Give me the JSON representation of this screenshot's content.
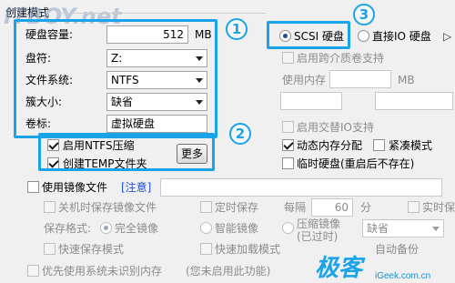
{
  "header": {
    "title": "创建模式",
    "watermark_top": "ITBOY.net"
  },
  "left_panel": {
    "size": {
      "label": "硬盘容量:",
      "value": "512",
      "unit": "MB"
    },
    "drive": {
      "label": "盘符:",
      "value": "Z:"
    },
    "filesystem": {
      "label": "文件系统:",
      "value": "NTFS"
    },
    "cluster": {
      "label": "簇大小:",
      "value": "缺省"
    },
    "volume": {
      "label": "卷标:",
      "value": "虚拟硬盘"
    }
  },
  "options_box": {
    "ntfs_compress": {
      "label": "启用NTFS压缩",
      "checked": true
    },
    "create_temp": {
      "label": "创建TEMP文件夹",
      "checked": true
    },
    "more_button": "更多"
  },
  "mode": {
    "scsi": {
      "label": "SCSI 硬盘",
      "selected": true
    },
    "direct_io": {
      "label": "直接IO 硬盘",
      "selected": false
    },
    "more_arrow": "▷"
  },
  "right_panel": {
    "cross_volume": {
      "label": "启用跨介质卷支持",
      "checked": false
    },
    "memory": {
      "label": "使用内存",
      "unit": "MB"
    },
    "swap_io": {
      "label": "启用交替IO支持",
      "checked": false
    },
    "dynamic_mem": {
      "label": "动态内存分配",
      "checked": true
    },
    "compact": {
      "label": "紧凑模式",
      "checked": false
    },
    "temp_disk": {
      "label": "临时硬盘(重启后不存在)",
      "checked": false
    }
  },
  "image": {
    "use_image": {
      "label": "使用镜像文件",
      "checked": false
    },
    "note_link": "[注意]",
    "save_on_shutdown": {
      "label": "关机时保存镜像文件",
      "checked": false
    },
    "timed_save": {
      "label": "定时保存",
      "checked": false
    },
    "interval": {
      "label": "每隔",
      "value": "60",
      "unit": "分"
    },
    "realtime": {
      "label": "实时保"
    },
    "format_label": "保存格式:",
    "format_full": {
      "label": "完全镜像",
      "selected": true
    },
    "format_smart": {
      "label": "智能镜像",
      "selected": false
    },
    "format_compressed": {
      "label": "压缩镜像",
      "sub": "(已过时)",
      "selected": false
    },
    "compress_select": "缺省",
    "fast_save": {
      "label": "快速保存模式",
      "checked": false
    },
    "fast_load": {
      "label": "快速加载模式",
      "checked": false
    },
    "auto_backup": {
      "label": "自动备份"
    },
    "priority_system": {
      "label": "优先使用系统未识别内存",
      "checked": false
    },
    "not_enabled_note": "(您未启用此功能)"
  },
  "annotations": {
    "one": "1",
    "two": "2",
    "three": "3"
  },
  "watermark": {
    "brand": "极客",
    "site": "iGeek.com.cn"
  },
  "colors": {
    "highlight": "#1aa3e8",
    "link": "#1a4fd6"
  }
}
